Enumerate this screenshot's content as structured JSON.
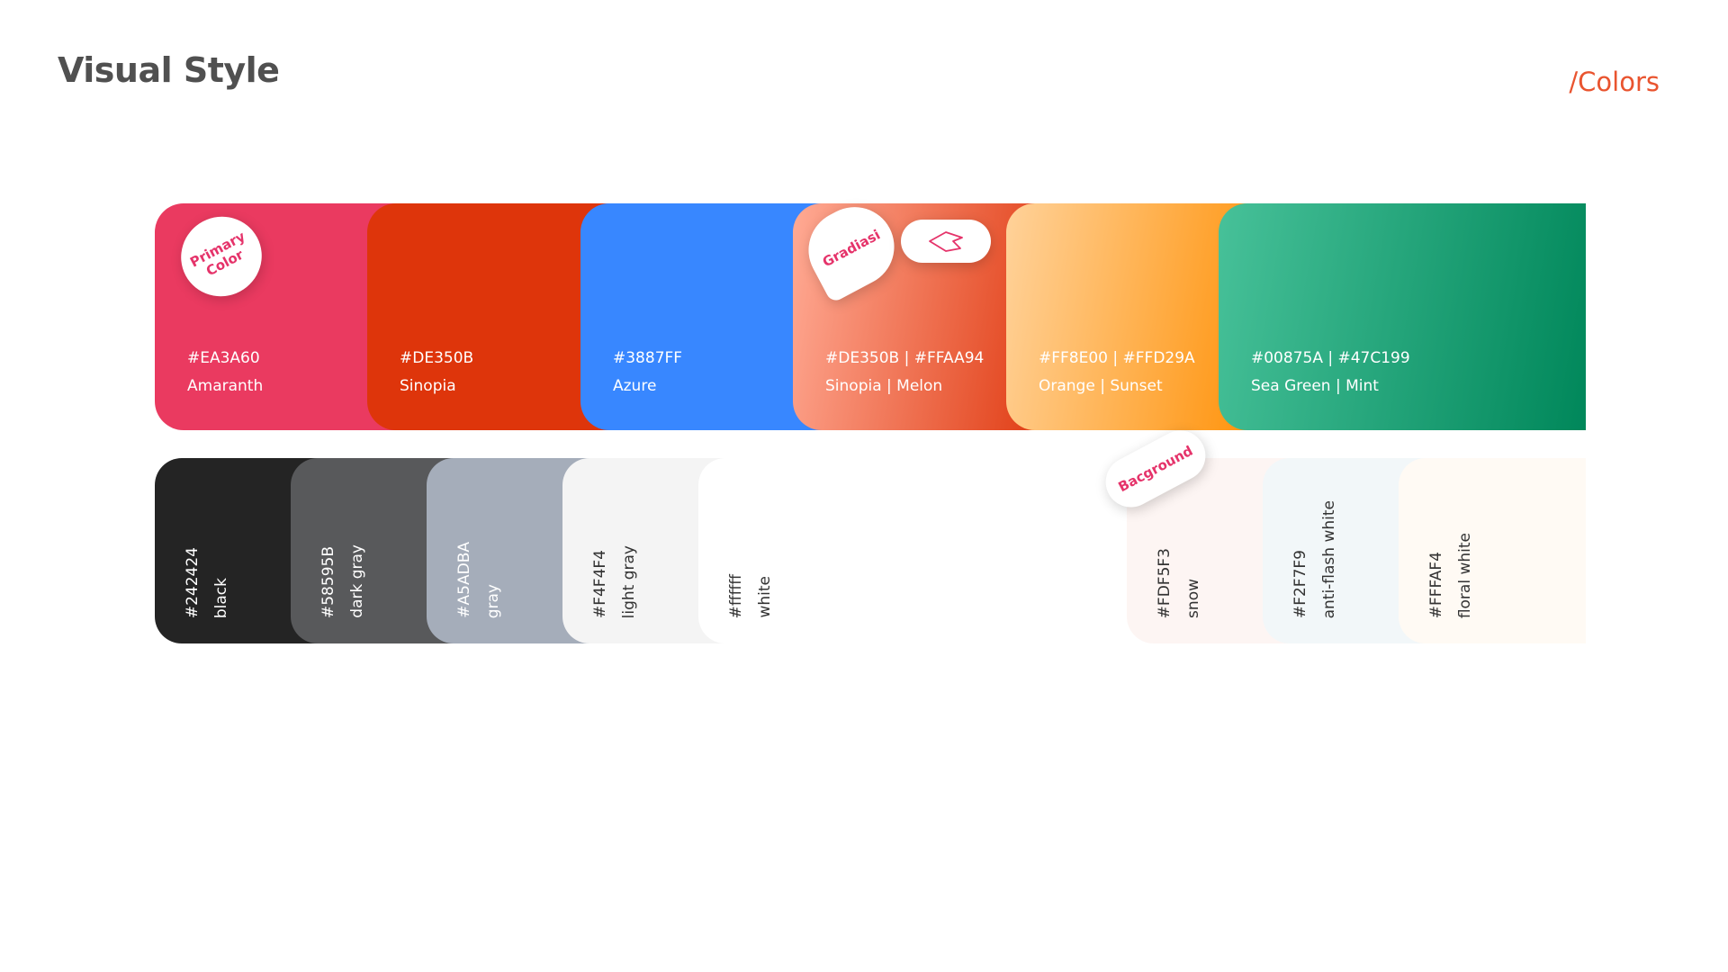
{
  "header": {
    "title": "Visual Style",
    "section": "/Colors"
  },
  "badges": {
    "primary": "Primary Color",
    "gradient": "Gradiasi",
    "background": "Bacground",
    "pill_icon": "gradient-direction-icon"
  },
  "primary_colors": [
    {
      "hex": "#EA3A60",
      "name": "Amaranth",
      "color": "#EA3A60"
    },
    {
      "hex": "#DE350B",
      "name": "Sinopia",
      "color": "#DE350B"
    },
    {
      "hex": "#3887FF",
      "name": "Azure",
      "color": "#3887FF"
    },
    {
      "hex": "#DE350B | #FFAA94",
      "name": "Sinopia | Melon",
      "color_from": "#FFAA94",
      "color_to": "#DE350B"
    },
    {
      "hex": "#FF8E00 | #FFD29A",
      "name": "Orange | Sunset",
      "color_from": "#FFD29A",
      "color_to": "#FF8E00"
    },
    {
      "hex": "#00875A | #47C199",
      "name": "Sea Green | Mint",
      "color_from": "#47C199",
      "color_to": "#00875A"
    }
  ],
  "neutral_colors": [
    {
      "hex": "#242424",
      "name": "black",
      "color": "#242424",
      "text_color": "#ffffff"
    },
    {
      "hex": "#58595B",
      "name": "dark gray",
      "color": "#58595B",
      "text_color": "#ffffff"
    },
    {
      "hex": "#A5ADBA",
      "name": "gray",
      "color": "#A5ADBA",
      "text_color": "#ffffff"
    },
    {
      "hex": "#F4F4F4",
      "name": "light gray",
      "color": "#F4F4F4",
      "text_color": "#333333"
    },
    {
      "hex": "#ffffff",
      "name": "white",
      "color": "#ffffff",
      "text_color": "#333333"
    }
  ],
  "background_colors": [
    {
      "hex": "#FDF5F3",
      "name": "snow",
      "color": "#FDF5F3",
      "text_color": "#333333"
    },
    {
      "hex": "#F2F7F9",
      "name": "anti-flash white",
      "color": "#F2F7F9",
      "text_color": "#333333"
    },
    {
      "hex": "#FFFAF4",
      "name": "floral white",
      "color": "#FFFAF4",
      "text_color": "#333333"
    }
  ]
}
